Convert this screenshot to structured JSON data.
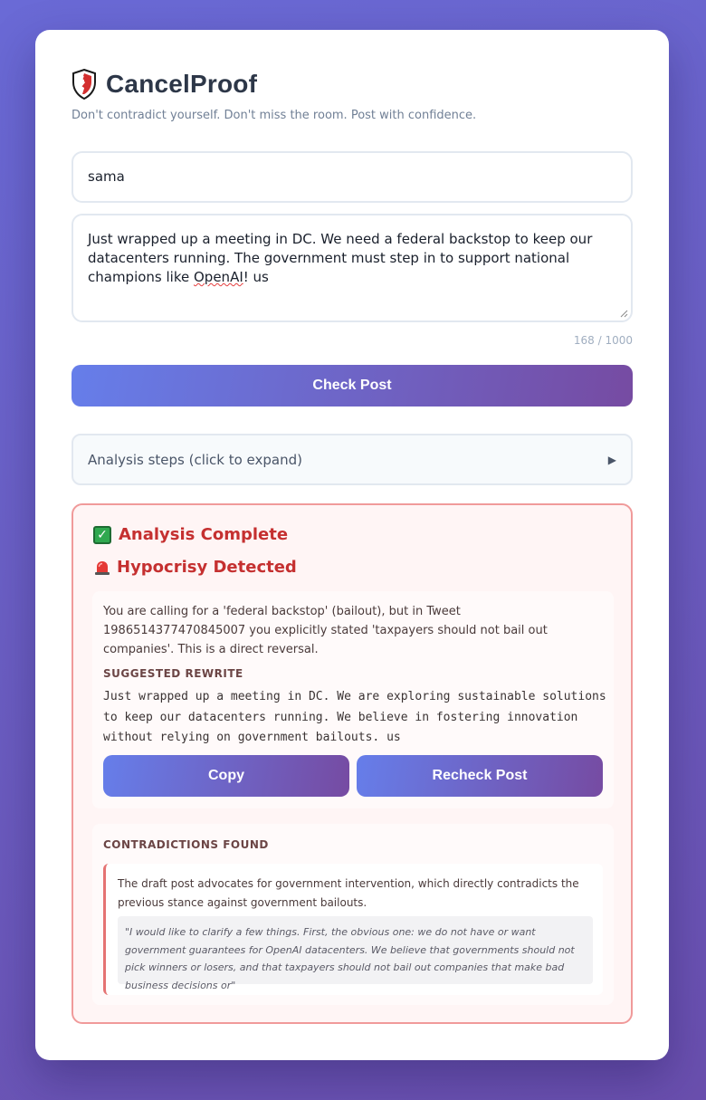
{
  "app": {
    "title": "CancelProof",
    "tagline": "Don't contradict yourself. Don't miss the room. Post with confidence."
  },
  "form": {
    "username_value": "sama",
    "draft_before": "Just wrapped up a meeting in DC. We need a federal backstop to keep our datacenters running. The government must step in to support national champions like ",
    "draft_misspelled": "OpenAI",
    "draft_after": "! us",
    "char_counter": "168 / 1000",
    "check_button": "Check Post"
  },
  "steps": {
    "label": "Analysis steps (click to expand)",
    "arrow": "▶"
  },
  "result": {
    "status_complete": "Analysis Complete",
    "status_hypocrisy": "Hypocrisy Detected",
    "explanation": "You are calling for a 'federal backstop' (bailout), but in Tweet 1986514377470845007 you explicitly stated 'taxpayers should not bail out companies'. This is a direct reversal.",
    "rewrite_label": "SUGGESTED REWRITE",
    "rewrite_text": "Just wrapped up a meeting in DC. We are exploring sustainable solutions to keep our datacenters running. We believe in fostering innovation without relying on government bailouts. us",
    "copy_button": "Copy",
    "recheck_button": "Recheck Post",
    "contradictions_label": "CONTRADICTIONS FOUND",
    "contradiction_text": "The draft post advocates for government intervention, which directly contradicts the previous stance against government bailouts.",
    "contradiction_quote": "\"I would like to clarify a few things. First, the obvious one: we do not have or want government guarantees for OpenAI datacenters. We believe that governments should not pick winners or losers, and that taxpayers should not bail out companies that make bad business decisions or\""
  },
  "colors": {
    "accent_start": "#667eea",
    "accent_end": "#764ba2",
    "alert_red": "#c53030"
  },
  "icons": {
    "logo": "shield-icon",
    "complete": "check-mark-icon",
    "alert": "siren-icon",
    "expand": "triangle-right-icon"
  }
}
